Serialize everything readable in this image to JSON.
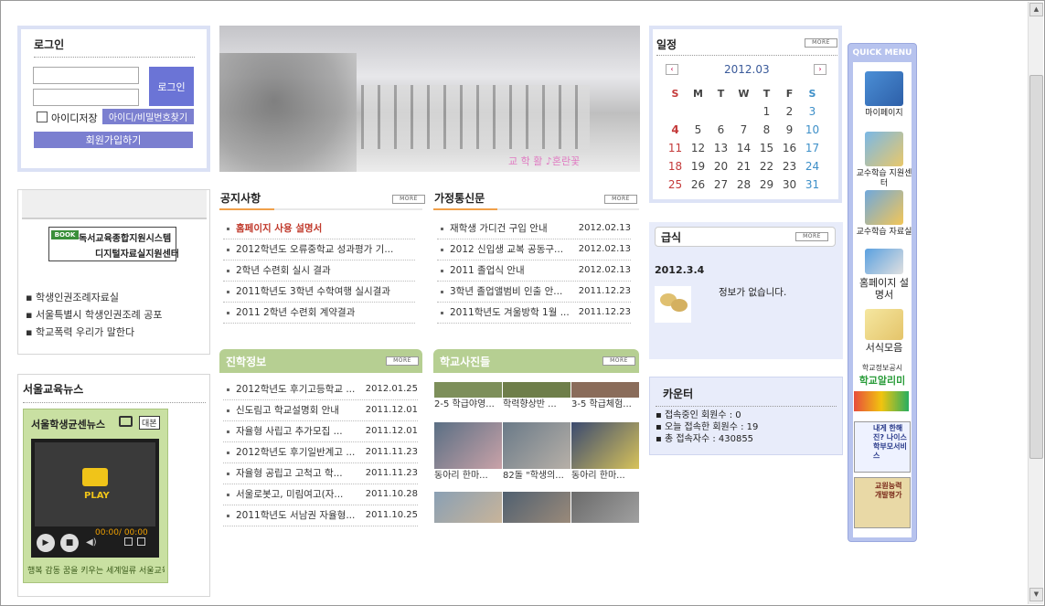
{
  "login": {
    "title": "로그인",
    "button": "로그인",
    "save_id": "아이디저장",
    "find": "아이디/비밀번호찾기",
    "join": "회원가입하기"
  },
  "banner": {
    "line1": "독서교육종합지원시스템",
    "line2": "디지털자료실지원센터",
    "book": "BOOK"
  },
  "left_links": [
    "학생인권조례자료실",
    "서울특별시 학생인권조례 공포",
    "학교폭력 우리가 말한다"
  ],
  "news": {
    "title": "서울교육뉴스",
    "video_title": "서울학생균센뉴스",
    "video_tag": "대본",
    "play": "PLAY",
    "time": "00:00/ 00:00",
    "slogan": "행복 감동 꿈을 키우는 세계일류 서울교육"
  },
  "hero": {
    "caption": "교 학 활 ♪혼란꽃"
  },
  "more_label": "MORE",
  "notice": {
    "title": "공지사항",
    "items": [
      {
        "t": "홈페이지 사용 설명서",
        "d": ""
      },
      {
        "t": "2012학년도 오류중학교 성과평가 기...",
        "d": ""
      },
      {
        "t": "2학년 수련회 실시 결과",
        "d": ""
      },
      {
        "t": "2011학년도 3학년 수학여행 실시결과",
        "d": ""
      },
      {
        "t": "2011 2학년 수련회 계약결과",
        "d": ""
      }
    ]
  },
  "family": {
    "title": "가정통신문",
    "items": [
      {
        "t": "재학생 가디건 구입 안내",
        "d": "2012.02.13"
      },
      {
        "t": "2012 신입생 교복 공동구...",
        "d": "2012.02.13"
      },
      {
        "t": "2011 졸업식 안내",
        "d": "2012.02.13"
      },
      {
        "t": "3학년 졸업앨범비 인출 안...",
        "d": "2011.12.23"
      },
      {
        "t": "2011학년도 겨울방학 1월 ...",
        "d": "2011.12.23"
      }
    ]
  },
  "career": {
    "title": "진학정보",
    "items": [
      {
        "t": "2012학년도 후기고등학교 ...",
        "d": "2012.01.25"
      },
      {
        "t": "신도림고 학교설명회 안내",
        "d": "2011.12.01"
      },
      {
        "t": "자율형 사립고 추가모집 ...",
        "d": "2011.12.01"
      },
      {
        "t": "2012학년도 후기일반계고 ...",
        "d": "2011.11.23"
      },
      {
        "t": "자율형 공립고 고척고 학...",
        "d": "2011.11.23"
      },
      {
        "t": "서울로봇고, 미림여고(자...",
        "d": "2011.10.28"
      },
      {
        "t": "2011학년도 서남권 자율형...",
        "d": "2011.10.25"
      }
    ]
  },
  "photos": {
    "title": "학교사진들",
    "row1": [
      "2-5 학급야영...",
      "학력향상반 ...",
      "3-5 학급체험..."
    ],
    "row2": [
      "동아리 한마...",
      "82돌 \"학생의...",
      "동아리 한마..."
    ]
  },
  "schedule": {
    "title": "일정",
    "month": "2012.03",
    "weekdays": [
      "S",
      "M",
      "T",
      "W",
      "T",
      "F",
      "S"
    ],
    "weeks": [
      [
        "",
        "",
        "",
        "",
        "1",
        "2",
        "3"
      ],
      [
        "4",
        "5",
        "6",
        "7",
        "8",
        "9",
        "10"
      ],
      [
        "11",
        "12",
        "13",
        "14",
        "15",
        "16",
        "17"
      ],
      [
        "18",
        "19",
        "20",
        "21",
        "22",
        "23",
        "24"
      ],
      [
        "25",
        "26",
        "27",
        "28",
        "29",
        "30",
        "31"
      ]
    ]
  },
  "meal": {
    "title": "급식",
    "date": "2012.3.4",
    "empty": "정보가 없습니다."
  },
  "counter": {
    "title": "카운터",
    "lines": [
      "접속중인 회원수 : 0",
      "오늘 접속한 회원수 : 19",
      "총 접속자수 : 430855"
    ]
  },
  "quick": {
    "title": "QUICK MENU",
    "items": [
      "마이페이지",
      "교수학습 지원센터",
      "교수학습 자료실",
      "홈페이지 설명서",
      "서식모음"
    ],
    "alimi_top": "학교정보공시",
    "alimi": "학교알리미",
    "service": "내게 한해진? 나이스 학부모서비스",
    "slot3": "교원능력개발평가"
  },
  "colors": {
    "accent": "#7b7fd0",
    "green": "#b6cf92",
    "lavender": "#dde3f6"
  }
}
